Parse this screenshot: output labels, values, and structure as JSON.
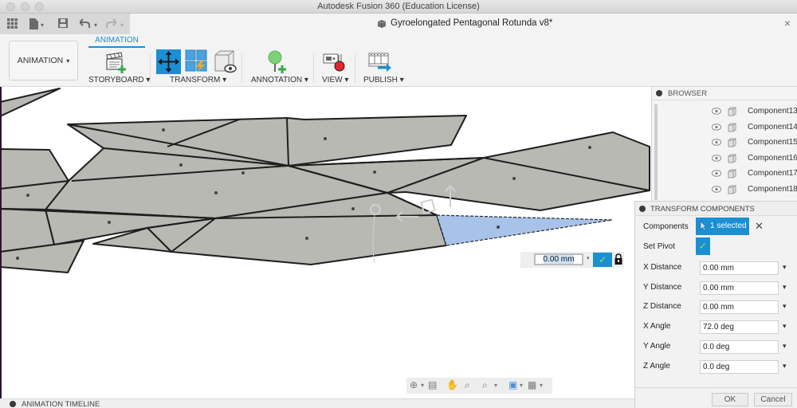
{
  "window": {
    "app_title": "Autodesk Fusion 360 (Education License)",
    "doc_title": "Gyroelongated Pentagonal Rotunda v8*",
    "doc_close": "×"
  },
  "quick_access": {
    "grid_icon": "apps-grid-icon",
    "file_icon": "file-icon",
    "save_icon": "save-icon",
    "undo_icon": "undo-icon",
    "redo_icon": "redo-icon",
    "caret": "▾"
  },
  "toolbar": {
    "workspace_label": "ANIMATION",
    "workspace_caret": "▾",
    "active_tab": "ANIMATION",
    "groups": [
      {
        "label": "STORYBOARD ▾"
      },
      {
        "label": "TRANSFORM ▾"
      },
      {
        "label": "ANNOTATION ▾"
      },
      {
        "label": "VIEW ▾"
      },
      {
        "label": "PUBLISH ▾"
      }
    ],
    "accent": "#1b8fd3"
  },
  "viewport": {
    "floating_input": {
      "value": "0.00 mm",
      "caret": "▾",
      "ok": "✓"
    },
    "selection_color": "#a7c3ea",
    "face_color": "#b9b9b4"
  },
  "navbar": {
    "icons": [
      {
        "name": "orbit-icon",
        "glyph": "⊕"
      },
      {
        "name": "look-at-icon",
        "glyph": "▤"
      },
      {
        "name": "pan-icon",
        "glyph": "✋"
      },
      {
        "name": "zoom-icon",
        "glyph": "⌕"
      },
      {
        "name": "fit-icon",
        "glyph": "⌕"
      },
      {
        "name": "display-settings-icon",
        "glyph": "▣"
      },
      {
        "name": "grid-settings-icon",
        "glyph": "▦"
      }
    ],
    "caret": "▾"
  },
  "timeline": {
    "label": "ANIMATION TIMELINE"
  },
  "browser": {
    "title": "BROWSER",
    "components": [
      {
        "name": "Component13..."
      },
      {
        "name": "Component14..."
      },
      {
        "name": "Component15..."
      },
      {
        "name": "Component16..."
      },
      {
        "name": "Component17..."
      },
      {
        "name": "Component18..."
      }
    ]
  },
  "dialog": {
    "title": "TRANSFORM COMPONENTS",
    "components_label": "Components",
    "selection": "1 selected",
    "clear": "✕",
    "set_pivot_label": "Set Pivot",
    "set_pivot_checked": true,
    "check": "✓",
    "fields": [
      {
        "label": "X Distance",
        "value": "0.00 mm"
      },
      {
        "label": "Y Distance",
        "value": "0.00 mm"
      },
      {
        "label": "Z Distance",
        "value": "0.00 mm"
      },
      {
        "label": "X Angle",
        "value": "72.0 deg"
      },
      {
        "label": "Y Angle",
        "value": "0.0 deg"
      },
      {
        "label": "Z Angle",
        "value": "0.0 deg"
      }
    ],
    "drop_caret": "▾",
    "ok_label": "OK",
    "cancel_label": "Cancel"
  }
}
